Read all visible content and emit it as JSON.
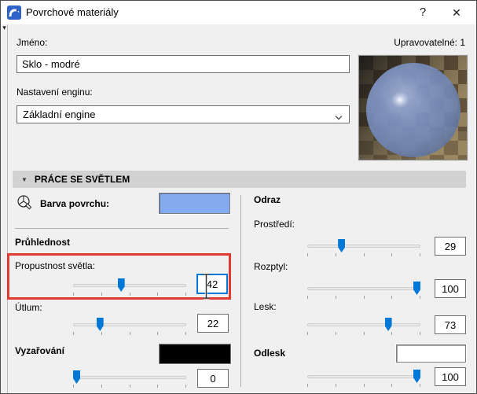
{
  "window": {
    "title": "Povrchové materiály"
  },
  "icons": {
    "app": "archicad-logo",
    "help": "?",
    "close": "✕",
    "panel_collapse": "▾",
    "section_collapse": "▼",
    "dropdown_chevron": "⌄",
    "surface_color": "color-wheel-brush"
  },
  "colors": {
    "accent_blue": "#0078d7",
    "focus_border": "#0078d7",
    "highlight_red": "#e23a2e",
    "surface_swatch": "#84aaf0",
    "emission_swatch": "#000000",
    "specular_swatch": "#ffffff"
  },
  "header": {
    "name_label": "Jméno:",
    "name_value": "Sklo - modré",
    "editable_label": "Upravovatelné: 1",
    "engine_label": "Nastavení enginu:",
    "engine_value": "Základní engine"
  },
  "section": {
    "title": "PRÁCE SE SVĚTLEM"
  },
  "left": {
    "surface_color_label": "Barva povrchu:",
    "transparency_title": "Průhlednost",
    "transmittance": {
      "label": "Propustnost světla:",
      "value": "42",
      "percent": 42
    },
    "attenuation": {
      "label": "Útlum:",
      "value": "22",
      "percent": 22
    },
    "emission_label": "Vyzařování",
    "emission": {
      "value": "0",
      "percent": 0
    }
  },
  "right": {
    "reflection_title": "Odraz",
    "ambient": {
      "label": "Prostředí:",
      "value": "29",
      "percent": 29
    },
    "diffuse": {
      "label": "Rozptyl:",
      "value": "100",
      "percent": 100
    },
    "shininess": {
      "label": "Lesk:",
      "value": "73",
      "percent": 73
    },
    "specular_label": "Odlesk",
    "specular": {
      "value": "100",
      "percent": 100
    }
  }
}
